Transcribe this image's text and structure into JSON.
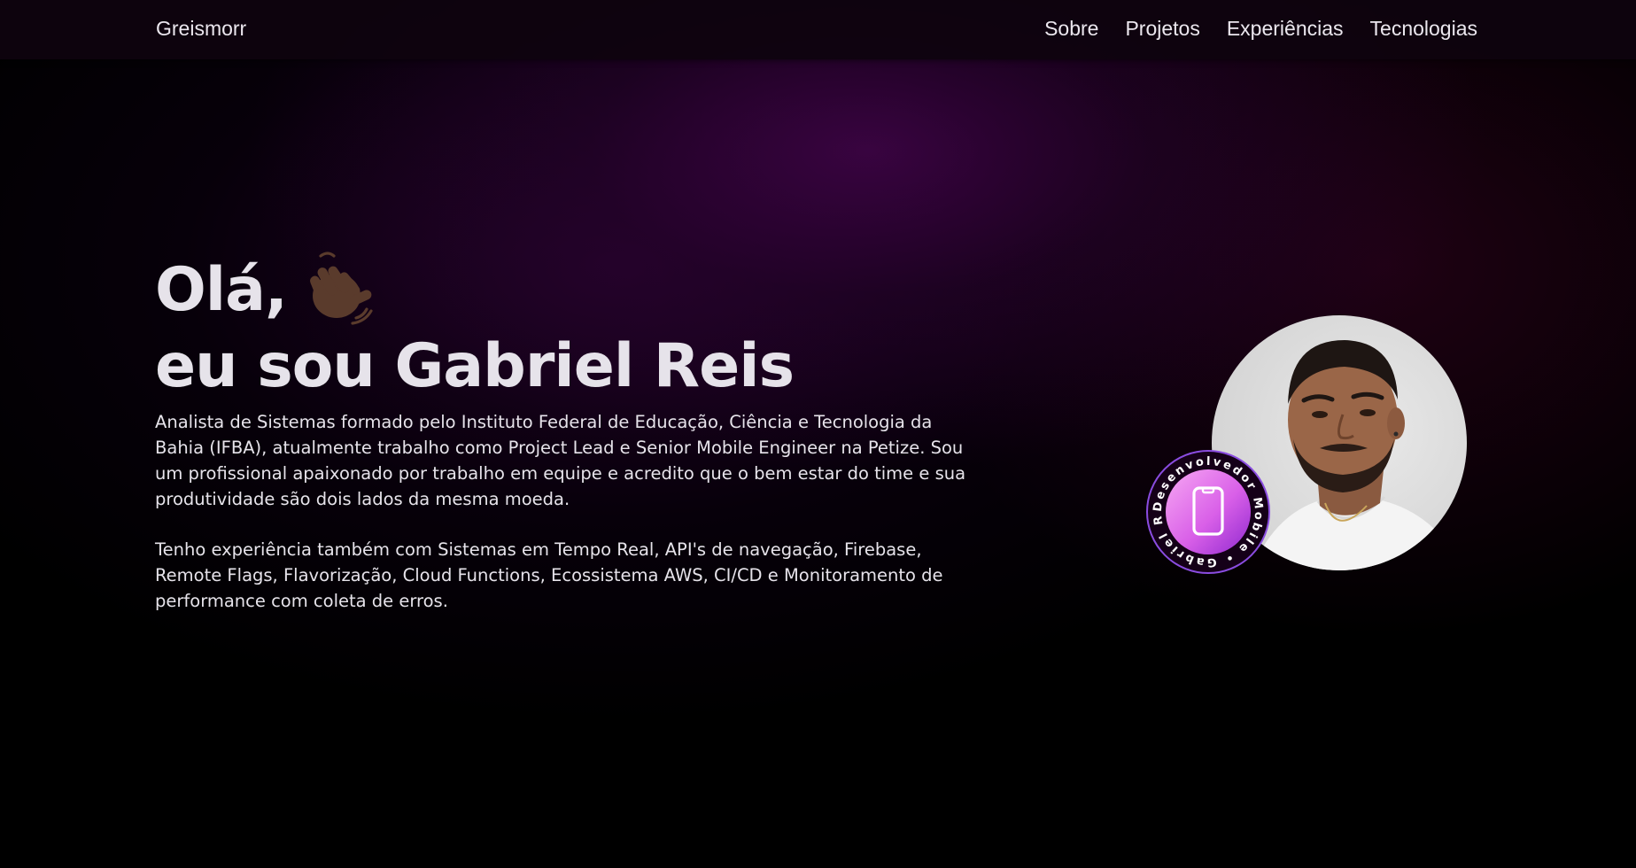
{
  "nav": {
    "brand": "Greismorr",
    "links": [
      "Sobre",
      "Projetos",
      "Experiências",
      "Tecnologias"
    ]
  },
  "hero": {
    "greeting": "Olá,",
    "name_line": "eu sou Gabriel Reis",
    "paragraph1": "Analista de Sistemas formado pelo Instituto Federal de Educação, Ciência e Tecnologia da Bahia (IFBA), atualmente trabalho como Project Lead e Senior Mobile Engineer na Petize. Sou um profissional apaixonado por trabalho em equipe e acredito que o bem estar do time e sua produtividade são dois lados da mesma moeda.",
    "paragraph2": "Tenho experiência também com Sistemas em Tempo Real, API's de navegação, Firebase, Remote Flags, Flavorização, Cloud Functions, Ecossistema AWS, CI/CD e Monitoramento de performance com coleta de erros."
  },
  "badge": {
    "ring_text": "Desenvolvedor Mobile • Gabriel Reis •",
    "icon": "smartphone-icon"
  },
  "icons": {
    "wave": "waving-hand-icon",
    "profile": "profile-photo"
  },
  "colors": {
    "background": "#000000",
    "glow": "#2a0433",
    "text": "#e6e3ea",
    "badge_gradient_start": "#f59ef2",
    "badge_gradient_end": "#a72fd8",
    "badge_ring": "#8a4ce0",
    "wave_skin": "#5a3b2c"
  }
}
